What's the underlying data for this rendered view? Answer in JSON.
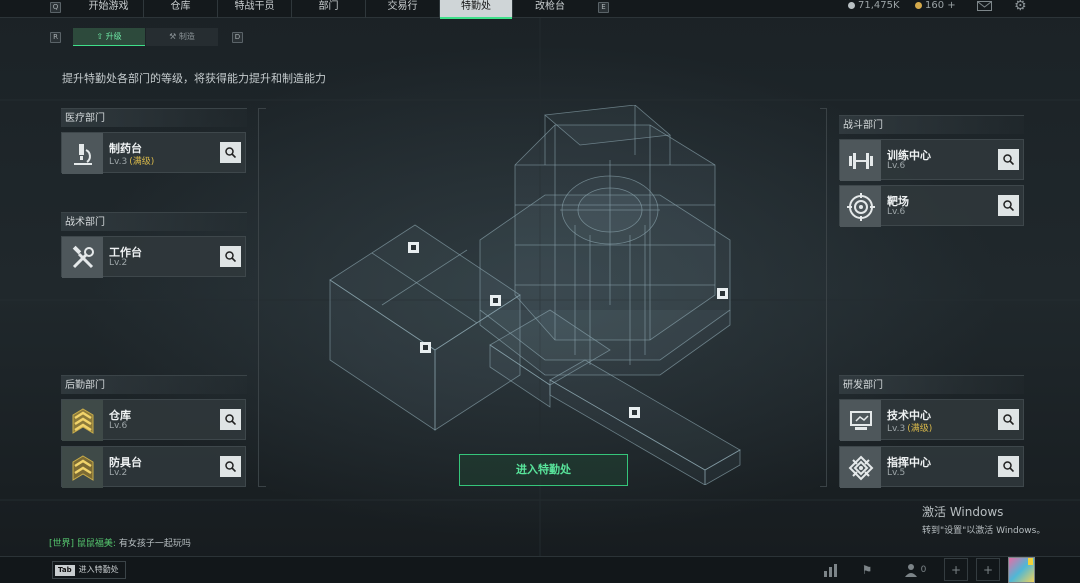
{
  "nav": {
    "left_key": "Q",
    "right_key": "E",
    "tabs": [
      "开始游戏",
      "仓库",
      "特战干员",
      "部门",
      "交易行",
      "特勤处",
      "改枪台"
    ],
    "active": "特勤处"
  },
  "resources": {
    "currency_a": "71,475K",
    "currency_b": "160"
  },
  "subnav": {
    "left_key": "R",
    "right_key": "D",
    "upgrade": "升级",
    "craft": "制造"
  },
  "description": "提升特勤处各部门的等级，将获得能力提升和制造能力",
  "departments": {
    "medical": {
      "title": "医疗部门",
      "items": [
        {
          "name": "制药台",
          "level": "Lv.3",
          "max": "(满级)"
        }
      ]
    },
    "tactical": {
      "title": "战术部门",
      "items": [
        {
          "name": "工作台",
          "level": "Lv.2"
        }
      ]
    },
    "logistics": {
      "title": "后勤部门",
      "items": [
        {
          "name": "仓库",
          "level": "Lv.6"
        },
        {
          "name": "防具台",
          "level": "Lv.2"
        }
      ]
    },
    "combat": {
      "title": "战斗部门",
      "items": [
        {
          "name": "训练中心",
          "level": "Lv.6"
        },
        {
          "name": "靶场",
          "level": "Lv.6"
        }
      ]
    },
    "research": {
      "title": "研发部门",
      "items": [
        {
          "name": "技术中心",
          "level": "Lv.3",
          "max": "(满级)"
        },
        {
          "name": "指挥中心",
          "level": "Lv.5"
        }
      ]
    }
  },
  "enter_button": "进入特勤处",
  "chat": {
    "channel": "[世界]",
    "user": "鼠鼠福美:",
    "message": "有女孩子一起玩吗"
  },
  "bottom": {
    "tab_key": "Tab",
    "tab_label": "进入特勤处",
    "friends_count": "0"
  },
  "watermark": {
    "title": "激活 Windows",
    "subtitle": "转到\"设置\"以激活 Windows。"
  },
  "colors": {
    "accent": "#3fe08a",
    "max_level": "#d8b84a"
  }
}
